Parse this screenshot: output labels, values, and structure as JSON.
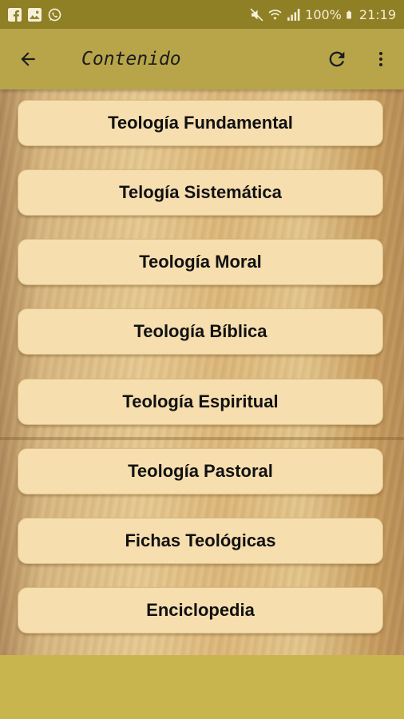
{
  "status_bar": {
    "battery_percent": "100%",
    "time": "21:19"
  },
  "app_bar": {
    "title": "Contenido"
  },
  "menu": {
    "items": [
      {
        "label": "Teología Fundamental"
      },
      {
        "label": "Telogía Sistemática"
      },
      {
        "label": "Teología Moral"
      },
      {
        "label": "Teología Bíblica"
      },
      {
        "label": "Teología Espiritual"
      },
      {
        "label": "Teología Pastoral"
      },
      {
        "label": "Fichas Teológicas"
      },
      {
        "label": "Enciclopedia"
      }
    ]
  },
  "icons": {
    "back": "arrow-back-icon",
    "refresh": "refresh-icon",
    "more": "more-vert-icon",
    "status_left": [
      "facebook-icon",
      "image-icon",
      "whatsapp-icon"
    ],
    "status_right": [
      "mute-icon",
      "wifi-icon",
      "signal-icon",
      "battery-icon"
    ]
  },
  "colors": {
    "status_bar": "#8f7f25",
    "app_bar": "#b8a54a",
    "button_fill": "#f6deaf",
    "bottom_band": "#c9b54d"
  }
}
